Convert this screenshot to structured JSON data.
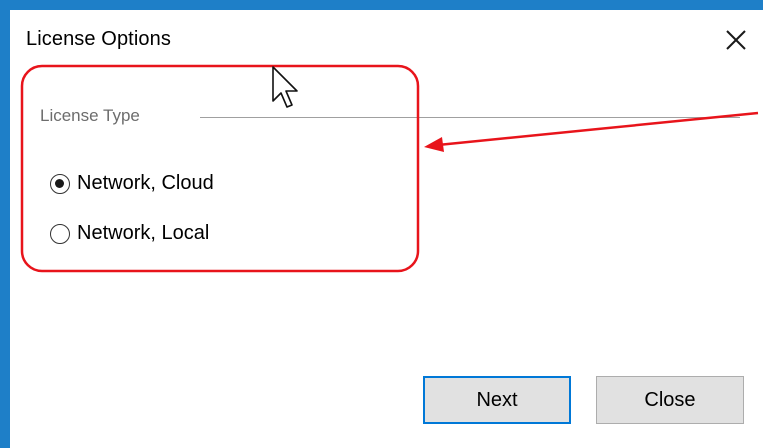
{
  "dialog": {
    "title": "License Options",
    "close_icon": "close-x-icon"
  },
  "license_group": {
    "label": "License Type",
    "options": [
      {
        "label": "Network, Cloud",
        "selected": true
      },
      {
        "label": "Network, Local",
        "selected": false
      }
    ]
  },
  "buttons": {
    "next_label": "Next",
    "close_label": "Close"
  },
  "annotation": {
    "highlight_color": "#e8141b",
    "shape": "rounded-rectangle-with-arrow"
  },
  "colors": {
    "window_border": "#1e7fc8",
    "default_button_border": "#0078d7",
    "button_bg": "#e1e1e1"
  }
}
